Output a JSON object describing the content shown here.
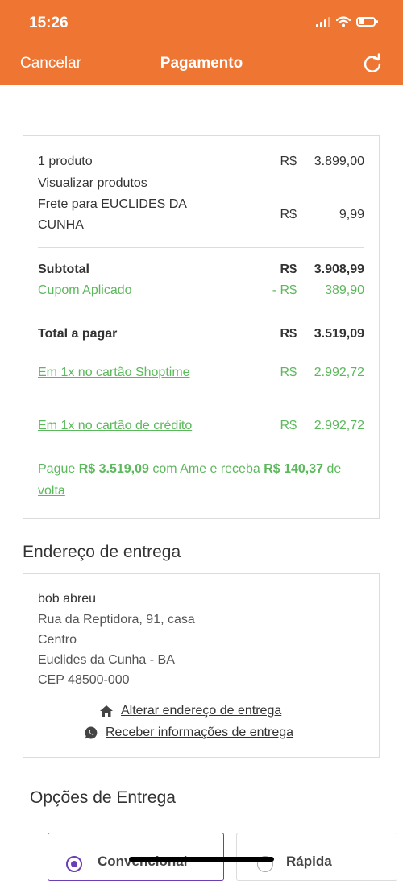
{
  "status_bar": {
    "time": "15:26"
  },
  "header": {
    "cancel_label": "Cancelar",
    "title": "Pagamento",
    "refresh_icon": "refresh-icon"
  },
  "summary": {
    "product_count": "1 produto",
    "product_currency": "R$",
    "product_value": "3.899,00",
    "view_products_link": "Visualizar produtos",
    "shipping_label_line1": "Frete para EUCLIDES DA",
    "shipping_label_line2": "CUNHA",
    "shipping_currency": "R$",
    "shipping_value": "9,99",
    "subtotal_label": "Subtotal",
    "subtotal_currency": "R$",
    "subtotal_value": "3.908,99",
    "coupon_label": "Cupom Aplicado",
    "coupon_currency": "- R$",
    "coupon_value": "389,90",
    "total_label": "Total a pagar",
    "total_currency": "R$",
    "total_value": "3.519,09",
    "shoptime_card_link": "Em 1x no cartão Shoptime",
    "shoptime_currency": "R$",
    "shoptime_value": "2.992,72",
    "credit_card_link": "Em 1x no cartão de crédito",
    "credit_currency": "R$",
    "credit_value": "2.992,72",
    "ame_prefix": "Pague ",
    "ame_amount": "R$ 3.519,09",
    "ame_middle": " com Ame e receba ",
    "ame_cashback": "R$ 140,37",
    "ame_suffix": " de volta"
  },
  "address_section": {
    "title": "Endereço de entrega",
    "name": "bob abreu",
    "street": "Rua da Reptidora, 91, casa",
    "district": "Centro",
    "city": "Euclides da Cunha - BA",
    "cep": "CEP 48500-000",
    "change_address_link": "Alterar endereço de entrega",
    "receive_info_link": "Receber informações de entrega"
  },
  "delivery_options": {
    "title": "Opções de Entrega",
    "options": [
      {
        "label": "Convencional",
        "selected": true
      },
      {
        "label": "Rápida",
        "selected": false
      }
    ]
  },
  "colors": {
    "header": "#ef7533",
    "green": "#5cb85c",
    "accent": "#6a3fb5"
  }
}
